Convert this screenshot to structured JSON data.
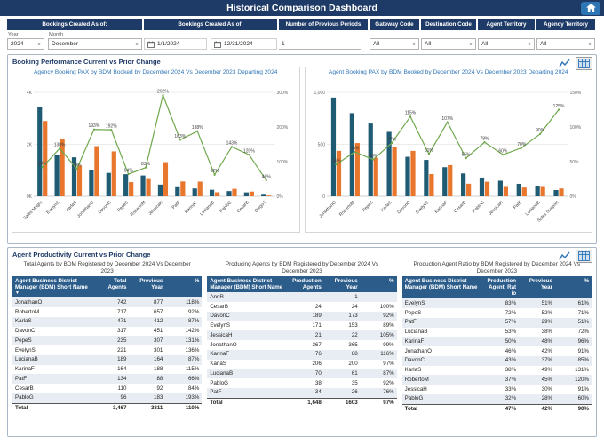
{
  "title_bar": {
    "title": "Historical Comparison Dashboard"
  },
  "icons": {
    "home_icon": "house",
    "calendar_icon": "calendar",
    "chevron_down_icon": "∨",
    "line_chart_icon": "line-chart",
    "table_icon": "table-grid",
    "sort_desc_icon": "▼"
  },
  "colors": {
    "navy": "#1E3A66",
    "accent": "#2E75B6",
    "current_bar": "#1F5C74",
    "prior_bar": "#E8762D",
    "line": "#6FA84C",
    "table_header_bg": "#2B5C8A",
    "zebra": "#E8EDF3"
  },
  "filters": {
    "headers": [
      "Bookings Created As of:",
      "Bookings Created As of:",
      "Number of Previous Periods",
      "Gateway Code",
      "Destination Code",
      "Agent Territory",
      "Agency Territory"
    ],
    "year": {
      "label": "Year",
      "value": "2024"
    },
    "month": {
      "label": "Month",
      "value": "December"
    },
    "date_start": "1/1/2024",
    "date_end": "12/31/2024",
    "periods": "1",
    "gateway": "All",
    "destination": "All",
    "agent_territory": "All",
    "agency_territory": "All"
  },
  "booking_section": {
    "title": "Booking Performance Current vs Prior Change"
  },
  "productivity_section": {
    "title": "Agent Productivity Current vs Prior Change"
  },
  "chart_data": [
    {
      "type": "bar",
      "subtype": "combo-bar-line",
      "title": "Agency Booking PAX by BDM Booked by December 2024 Vs December 2023 Departing 2024",
      "categories": [
        "Sales Mngrs",
        "EvelynS",
        "KarlaS",
        "JonathanO",
        "DavonC",
        "PepeS",
        "RobertoM",
        "JessicaH",
        "PatF",
        "KarinaF",
        "LucianaB",
        "PabloG",
        "CesarB",
        "DiegoT"
      ],
      "series": [
        {
          "name": "Current PAX",
          "type": "bar",
          "values": [
            3450,
            1600,
            1500,
            1000,
            900,
            850,
            800,
            450,
            350,
            300,
            250,
            200,
            150,
            60
          ]
        },
        {
          "name": "Prior PAX",
          "type": "bar",
          "values": [
            2898,
            2208,
            1185,
            1930,
            1728,
            544,
            664,
            1314,
            571,
            564,
            155,
            286,
            180,
            28
          ]
        },
        {
          "name": "% Change",
          "type": "line",
          "values": [
            84,
            138,
            79,
            193,
            192,
            64,
            83,
            292,
            163,
            188,
            62,
            143,
            120,
            46
          ],
          "labels": [
            "84%",
            "138%",
            "79%",
            "193%",
            "192%",
            "64%",
            "83%",
            "292%",
            "163%",
            "188%",
            "62%",
            "143%",
            "120%",
            "46%"
          ]
        }
      ],
      "y_left": {
        "max": 4000,
        "ticks": [
          [
            0,
            "0K"
          ],
          [
            2000,
            "2K"
          ],
          [
            4000,
            "4K"
          ]
        ]
      },
      "y_right": {
        "max": 300,
        "ticks": [
          [
            0,
            "0%"
          ],
          [
            100,
            "100%"
          ],
          [
            200,
            "200%"
          ],
          [
            300,
            "300%"
          ]
        ]
      },
      "legend": "none",
      "grid": true
    },
    {
      "type": "bar",
      "subtype": "combo-bar-line",
      "title": "Agent Booking PAX by BDM Booked by December 2024 Vs December 2023 Departing 2024",
      "categories": [
        "JonathanO",
        "RobertoM",
        "PepeS",
        "KarlaS",
        "DavonC",
        "EvelynS",
        "KarinaF",
        "CesarB",
        "PabloG",
        "JessicaH",
        "PatF",
        "LucianaB",
        "Sales Support"
      ],
      "series": [
        {
          "name": "Current PAX",
          "type": "bar",
          "values": [
            950,
            800,
            700,
            620,
            380,
            350,
            280,
            220,
            180,
            150,
            120,
            100,
            60
          ]
        },
        {
          "name": "Prior PAX",
          "type": "bar",
          "values": [
            437,
            512,
            371,
            477,
            437,
            214,
            300,
            121,
            140,
            90,
            84,
            90,
            75
          ]
        },
        {
          "name": "% Change",
          "type": "line",
          "values": [
            46,
            64,
            53,
            77,
            115,
            61,
            107,
            55,
            78,
            60,
            70,
            90,
            125
          ],
          "labels": [
            "46%",
            "64%",
            "53%",
            "77%",
            "115%",
            "61%",
            "107%",
            "55%",
            "78%",
            "60%",
            "70%",
            "90%",
            "125%"
          ]
        }
      ],
      "y_left": {
        "max": 1000,
        "ticks": [
          [
            0,
            "0"
          ],
          [
            500,
            "500"
          ],
          [
            1000,
            "1,000"
          ]
        ]
      },
      "y_right": {
        "max": 150,
        "ticks": [
          [
            0,
            "0%"
          ],
          [
            50,
            "50%"
          ],
          [
            100,
            "100%"
          ],
          [
            150,
            "150%"
          ]
        ]
      },
      "legend": "none",
      "grid": true
    }
  ],
  "tables": [
    {
      "title": "Total Agents by BDM Registered by December 2024 Vs December 2023",
      "columns": [
        "Agent Business District Manager (BDM) Short Name",
        "Total Agents",
        "Previous Year",
        "%"
      ],
      "sorted": true,
      "rows": [
        [
          "JonathanO",
          "742",
          "877",
          "118%"
        ],
        [
          "RobertoM",
          "717",
          "657",
          "92%"
        ],
        [
          "KarlaS",
          "471",
          "412",
          "87%"
        ],
        [
          "DavonC",
          "317",
          "451",
          "142%"
        ],
        [
          "PepeS",
          "235",
          "307",
          "131%"
        ],
        [
          "EvelynS",
          "221",
          "301",
          "136%"
        ],
        [
          "LucianaB",
          "189",
          "164",
          "87%"
        ],
        [
          "KarinaF",
          "164",
          "188",
          "115%"
        ],
        [
          "PatF",
          "134",
          "88",
          "66%"
        ],
        [
          "CesarB",
          "110",
          "92",
          "84%"
        ],
        [
          "PabloG",
          "96",
          "183",
          "193%"
        ]
      ],
      "total": [
        "Total",
        "3,467",
        "3811",
        "110%"
      ]
    },
    {
      "title": "Producing Agents by BDM Registered by December 2024 Vs December 2023",
      "columns": [
        "Agent Business District Manager (BDM) Short Name",
        "Production_Agents",
        "Previous Year",
        "%"
      ],
      "sorted": false,
      "rows": [
        [
          "AnnR",
          "",
          "1",
          ""
        ],
        [
          "CesarB",
          "24",
          "24",
          "100%"
        ],
        [
          "DavonC",
          "189",
          "173",
          "92%"
        ],
        [
          "EvelynS",
          "171",
          "153",
          "89%"
        ],
        [
          "JessicaH",
          "21",
          "22",
          "105%"
        ],
        [
          "JonathanO",
          "367",
          "365",
          "99%"
        ],
        [
          "KarinaF",
          "76",
          "88",
          "116%"
        ],
        [
          "KarlaS",
          "206",
          "200",
          "97%"
        ],
        [
          "LucianaB",
          "70",
          "61",
          "87%"
        ],
        [
          "PabloG",
          "38",
          "35",
          "92%"
        ],
        [
          "PatF",
          "34",
          "26",
          "76%"
        ]
      ],
      "total": [
        "Total",
        "1,648",
        "1603",
        "97%"
      ]
    },
    {
      "title": "Production Agent Ratio by BDM Registered by December 2024 Vs December 2023",
      "columns": [
        "Agent Business District Manager (BDM) Short Name",
        "Production_Agent_Ratio",
        "Previous Year",
        "%"
      ],
      "sorted": false,
      "rows": [
        [
          "EvelynS",
          "83%",
          "51%",
          "61%"
        ],
        [
          "PepeS",
          "72%",
          "52%",
          "71%"
        ],
        [
          "PatF",
          "57%",
          "29%",
          "51%"
        ],
        [
          "LucianaB",
          "53%",
          "38%",
          "72%"
        ],
        [
          "KarinaF",
          "50%",
          "48%",
          "96%"
        ],
        [
          "JonathanO",
          "46%",
          "42%",
          "91%"
        ],
        [
          "DavonC",
          "43%",
          "37%",
          "85%"
        ],
        [
          "KarlaS",
          "38%",
          "49%",
          "131%"
        ],
        [
          "RobertoM",
          "37%",
          "45%",
          "120%"
        ],
        [
          "JessicaH",
          "33%",
          "30%",
          "91%"
        ],
        [
          "PabloG",
          "32%",
          "28%",
          "60%"
        ]
      ],
      "total": [
        "Total",
        "47%",
        "42%",
        "90%"
      ]
    }
  ]
}
